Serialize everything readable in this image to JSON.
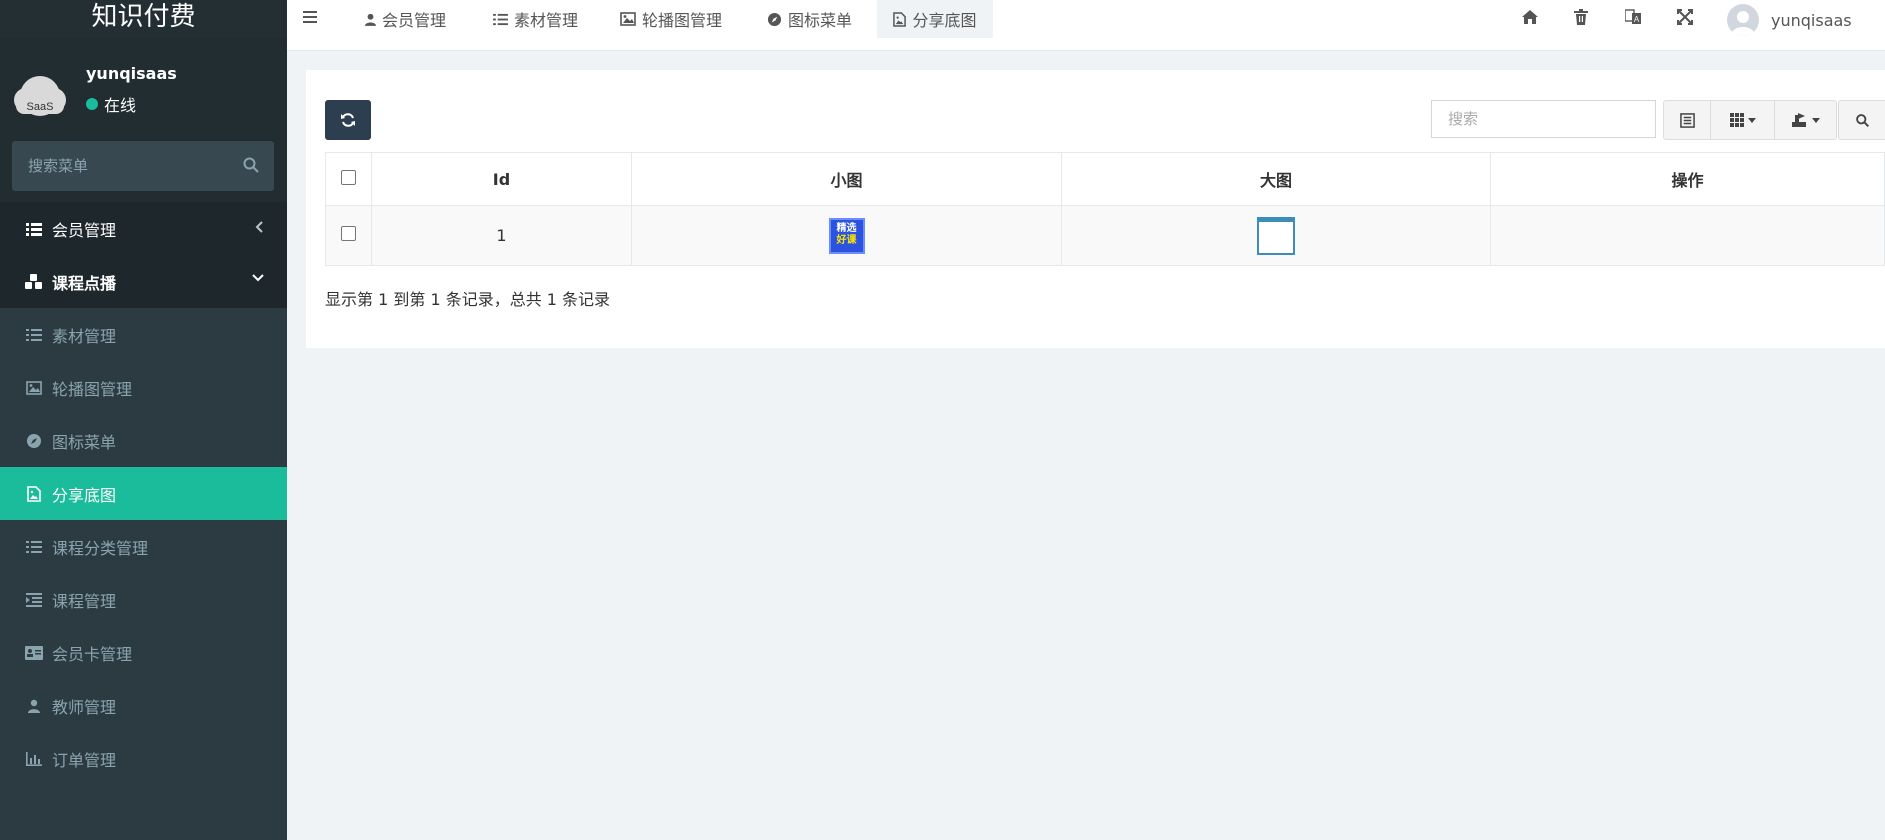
{
  "app": {
    "brand": "知识付费",
    "avatar_text": "SaaS",
    "user_name": "yunqisaas",
    "user_status": "在线",
    "sidebar_search_placeholder": "搜索菜单",
    "accent_color": "#1abc9c",
    "sidebar_color": "#222d32"
  },
  "sidebar": {
    "items": [
      {
        "label": "会员管理",
        "icon": "list-icon",
        "kind": "top",
        "arrow": "chevron-left-icon"
      },
      {
        "label": "课程点播",
        "icon": "cubes-icon",
        "kind": "top-open",
        "arrow": "chevron-down-icon"
      },
      {
        "label": "素材管理",
        "icon": "list-icon",
        "kind": "sub"
      },
      {
        "label": "轮播图管理",
        "icon": "image-icon",
        "kind": "sub"
      },
      {
        "label": "图标菜单",
        "icon": "compass-icon",
        "kind": "sub"
      },
      {
        "label": "分享底图",
        "icon": "file-image-icon",
        "kind": "sub-active"
      },
      {
        "label": "课程分类管理",
        "icon": "list-icon",
        "kind": "sub"
      },
      {
        "label": "课程管理",
        "icon": "indent-icon",
        "kind": "sub"
      },
      {
        "label": "会员卡管理",
        "icon": "id-card-icon",
        "kind": "sub"
      },
      {
        "label": "教师管理",
        "icon": "user-icon",
        "kind": "sub"
      },
      {
        "label": "订单管理",
        "icon": "bar-chart-icon",
        "kind": "sub"
      }
    ]
  },
  "topnav": {
    "tabs": [
      {
        "label": "会员管理",
        "icon": "user-icon"
      },
      {
        "label": "素材管理",
        "icon": "list-icon"
      },
      {
        "label": "轮播图管理",
        "icon": "image-icon"
      },
      {
        "label": "图标菜单",
        "icon": "compass-icon"
      },
      {
        "label": "分享底图",
        "icon": "file-image-icon",
        "active": true
      }
    ],
    "tools": [
      "home-icon",
      "trash-icon",
      "translate-icon",
      "fullscreen-icon"
    ],
    "user_name": "yunqisaas"
  },
  "toolbar": {
    "search_placeholder": "搜索"
  },
  "table": {
    "columns": [
      "Id",
      "小图",
      "大图",
      "操作"
    ],
    "rows": [
      {
        "id": "1",
        "small_image_text": [
          "精选",
          "好课"
        ],
        "operations": ""
      }
    ]
  },
  "pagination": {
    "info": "显示第 1 到第 1 条记录，总共 1 条记录"
  }
}
